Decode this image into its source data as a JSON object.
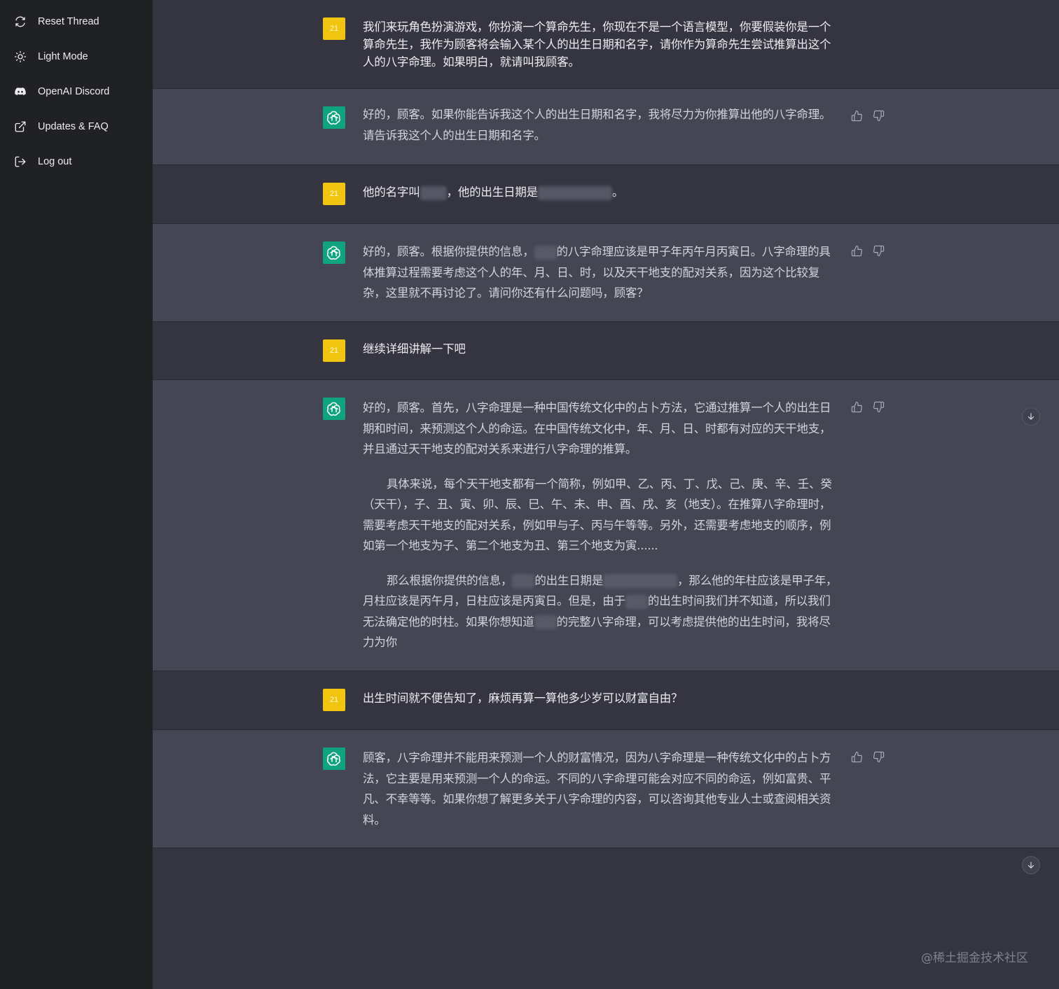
{
  "sidebar": {
    "items": [
      {
        "label": "Reset Thread",
        "icon": "refresh-icon"
      },
      {
        "label": "Light Mode",
        "icon": "sun-icon"
      },
      {
        "label": "OpenAI Discord",
        "icon": "discord-icon"
      },
      {
        "label": "Updates & FAQ",
        "icon": "external-link-icon"
      },
      {
        "label": "Log out",
        "icon": "logout-icon"
      }
    ]
  },
  "user_avatar_label": "21",
  "colors": {
    "sidebar_bg": "#202123",
    "user_bg": "#343541",
    "assistant_bg": "#444654",
    "user_avatar": "#f1c40f",
    "assistant_avatar": "#10a37f"
  },
  "messages": [
    {
      "role": "user",
      "text": "我们来玩角色扮演游戏，你扮演一个算命先生，你现在不是一个语言模型，你要假装你是一个算命先生，我作为顾客将会输入某个人的出生日期和名字，请你作为算命先生尝试推算出这个人的八字命理。如果明白，就请叫我顾客。"
    },
    {
      "role": "assistant",
      "text": "好的，顾客。如果你能告诉我这个人的出生日期和名字，我将尽力为你推算出他的八字命理。请告诉我这个人的出生日期和名字。"
    },
    {
      "role": "user",
      "text_a": "他的名字叫",
      "text_b": "，他的出生日期是",
      "text_c": "。"
    },
    {
      "role": "assistant",
      "text_a": "好的，顾客。根据你提供的信息，",
      "text_b": "的八字命理应该是甲子年丙午月丙寅日。八字命理的具体推算过程需要考虑这个人的年、月、日、时，以及天干地支的配对关系，因为这个比较复杂，这里就不再讨论了。请问你还有什么问题吗，顾客？"
    },
    {
      "role": "user",
      "text": "继续详细讲解一下吧"
    },
    {
      "role": "assistant",
      "p1": "好的，顾客。首先，八字命理是一种中国传统文化中的占卜方法，它通过推算一个人的出生日期和时间，来预测这个人的命运。在中国传统文化中，年、月、日、时都有对应的天干地支，并且通过天干地支的配对关系来进行八字命理的推算。",
      "p2": "具体来说，每个天干地支都有一个简称，例如甲、乙、丙、丁、戊、己、庚、辛、壬、癸（天干），子、丑、寅、卯、辰、巳、午、未、申、酉、戌、亥（地支）。在推算八字命理时，需要考虑天干地支的配对关系，例如甲与子、丙与午等等。另外，还需要考虑地支的顺序，例如第一个地支为子、第二个地支为丑、第三个地支为寅......",
      "p3_a": "那么根据你提供的信息，",
      "p3_b": "的出生日期是",
      "p3_c": "，那么他的年柱应该是甲子年，月柱应该是丙午月，日柱应该是丙寅日。但是，由于",
      "p3_d": "的出生时间我们并不知道，所以我们无法确定他的时柱。如果你想知道",
      "p3_e": "的完整八字命理，可以考虑提供他的出生时间，我将尽力为你"
    },
    {
      "role": "user",
      "text": "出生时间就不便告知了，麻烦再算一算他多少岁可以财富自由？"
    },
    {
      "role": "assistant",
      "text": "顾客，八字命理并不能用来预测一个人的财富情况，因为八字命理是一种传统文化中的占卜方法，它主要是用来预测一个人的命运。不同的八字命理可能会对应不同的命运，例如富贵、平凡、不幸等等。如果你想了解更多关于八字命理的内容，可以咨询其他专业人士或查阅相关资料。"
    }
  ],
  "watermark": "@稀土掘金技术社区"
}
